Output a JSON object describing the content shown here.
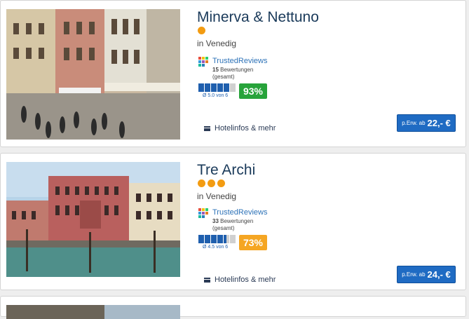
{
  "colors": {
    "accent": "#1f6bc3",
    "star": "#f39c12",
    "score_high": "#27a33a",
    "score_mid": "#f5a623"
  },
  "hotels": [
    {
      "name": "Minerva & Nettuno",
      "stars": 1,
      "location": "in Venedig",
      "reviews_brand": "TrustedReviews",
      "review_count": "15",
      "review_count_label": "Bewertungen",
      "review_count_note": "(gesamt)",
      "rating_bars_on": 5,
      "rating_bars_total": 6,
      "avg_text": "Ø 5.0 von 6",
      "score": "93%",
      "info_link": "Hotelinfos & mehr",
      "price_prefix": "p.Erw. ab",
      "price": "22,- €"
    },
    {
      "name": "Tre Archi",
      "stars": 3,
      "location": "in Venedig",
      "reviews_brand": "TrustedReviews",
      "review_count": "33",
      "review_count_label": "Bewertungen",
      "review_count_note": "(gesamt)",
      "rating_bars_on": 4.5,
      "rating_bars_total": 6,
      "avg_text": "Ø 4.5 von 6",
      "score": "73%",
      "info_link": "Hotelinfos & mehr",
      "price_prefix": "p.Erw. ab",
      "price": "24,- €"
    }
  ]
}
